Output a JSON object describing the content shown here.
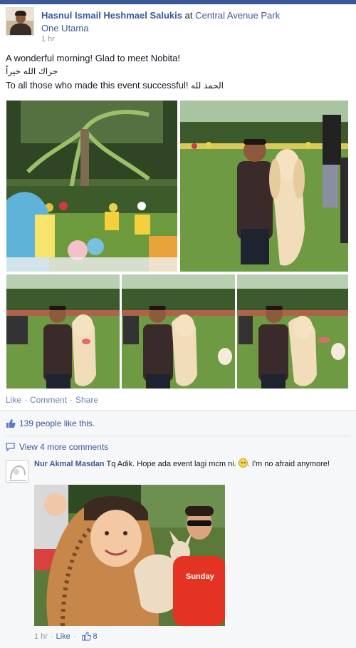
{
  "post": {
    "author": "Hasnul Ismail Heshmael Salukis",
    "at": "at",
    "location_line1": "Central Avenue Park",
    "location_line2": "One Utama",
    "time": "1 hr",
    "text_line1": "A wonderful morning! Glad to meet Nobita!",
    "text_line2": "جزاك الله خيراً",
    "text_line3_en": "To all those who made this event successful!",
    "text_line3_ar": "الحمد لله"
  },
  "actions": {
    "like": "Like",
    "comment": "Comment",
    "share": "Share",
    "separator": "·"
  },
  "ufi": {
    "likes_text": "139 people like this.",
    "more_comments": "View 4 more comments"
  },
  "comment": {
    "author": "Nur Akmal Masdan",
    "text_before_emoji": "Tq Adik. Hope ada event lagi mcm ni.",
    "text_after_emoji": ". I'm no afraid anymore!",
    "time": "1 hr",
    "like": "Like",
    "like_count": "8",
    "separator": "·",
    "photo_shirt_text": "Sunday"
  },
  "colors": {
    "brand": "#3b5998",
    "link": "#3b5998",
    "muted": "#9197a3",
    "ufi_bg": "#f6f7f9"
  },
  "icons": {
    "thumb": "thumbs-up-icon",
    "comment": "comment-bubble-icon",
    "emoji": "worried-face-emoji"
  }
}
